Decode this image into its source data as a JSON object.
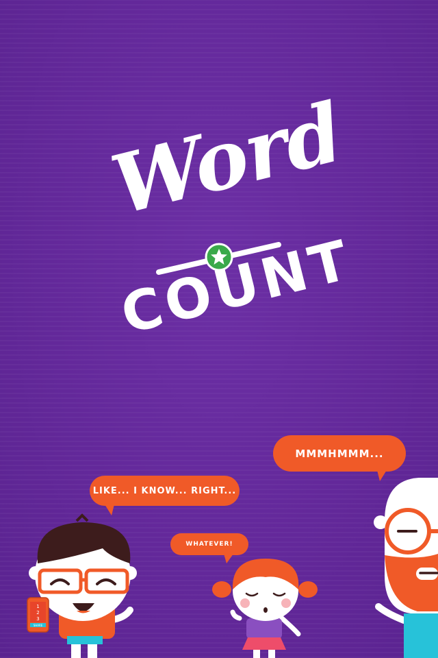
{
  "logo": {
    "word": "Word",
    "count": "COUNT"
  },
  "bubbles": {
    "boy": "LIKE... I KNOW... RIGHT...",
    "girl": "WHATEVER!",
    "man": "MMMHMMM..."
  },
  "phone": {
    "digits": [
      "1",
      "2",
      "3"
    ],
    "button": "SHARE"
  },
  "colors": {
    "background": "#6a2a9f",
    "bubble": "#f05a28",
    "accent_star": "#3aa94a"
  }
}
